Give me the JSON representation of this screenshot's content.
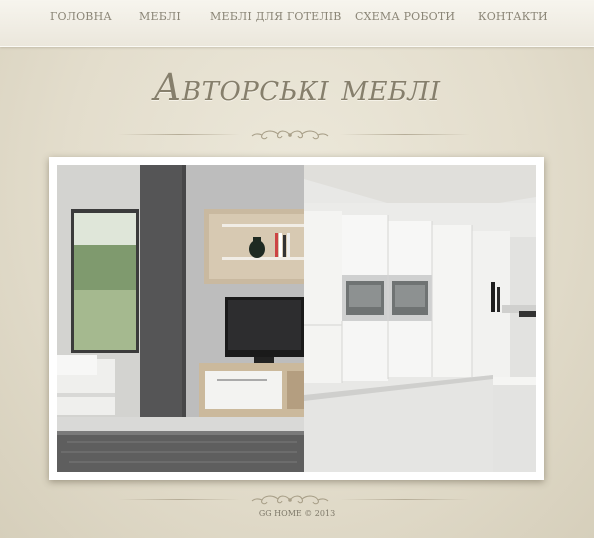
{
  "nav": {
    "items": [
      {
        "label": "ГОЛОВНА"
      },
      {
        "label": "МЕБЛІ"
      },
      {
        "label": "МЕБЛІ ДЛЯ ГОТЕЛІВ"
      },
      {
        "label": "СХЕМА РОБОТИ"
      },
      {
        "label": "КОНТАКТИ"
      }
    ]
  },
  "header": {
    "title": "Авторські меблі"
  },
  "hero": {
    "image": "interior-living-room-and-kitchen-photo"
  },
  "footer": {
    "copyright": "GG HOME © 2013"
  },
  "colors": {
    "background": "#e2dccb",
    "nav_background": "#f2f0e8",
    "nav_text": "#8a8576",
    "title_text": "#867f6c",
    "ornament": "#a89f88"
  }
}
